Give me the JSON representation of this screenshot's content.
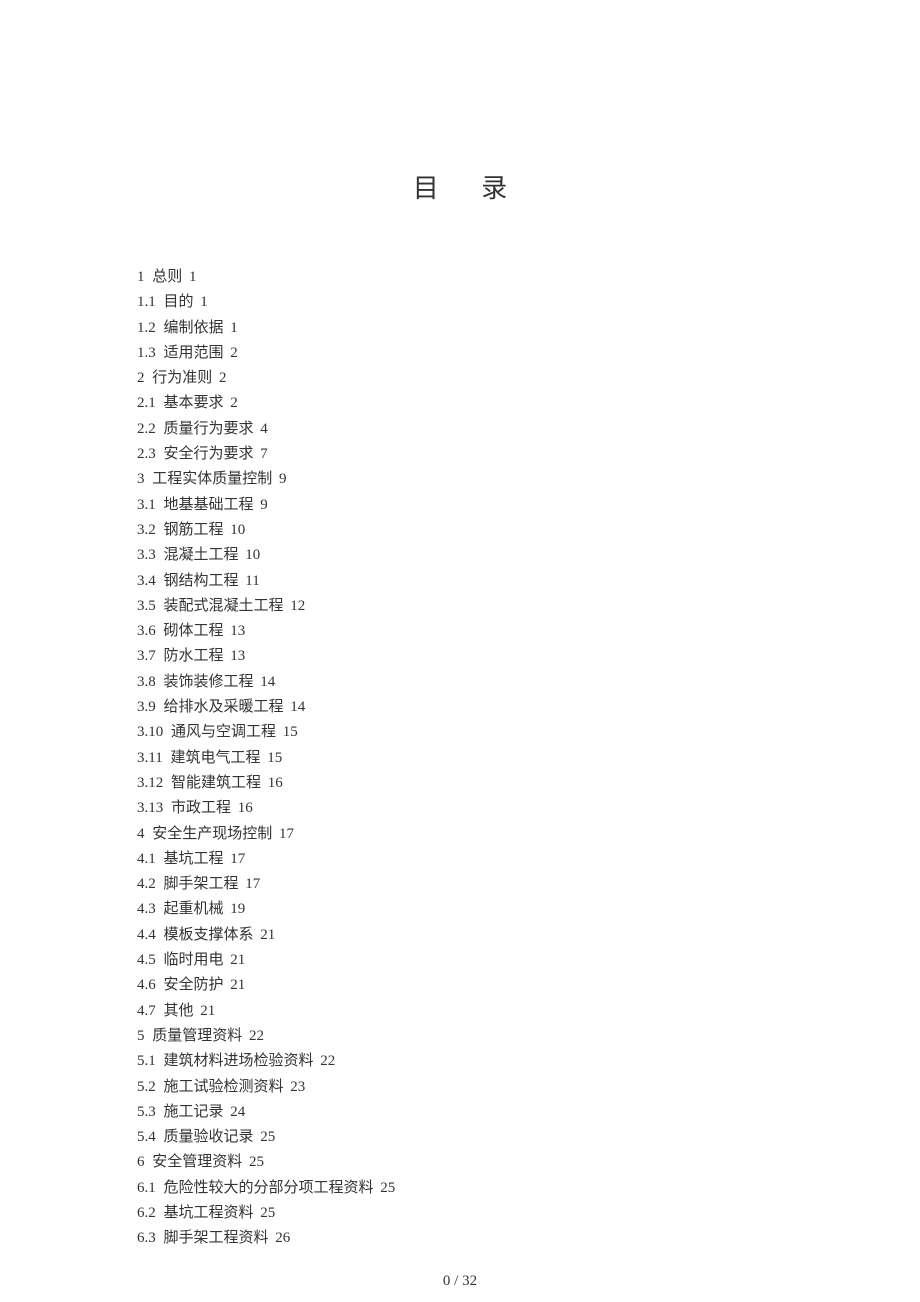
{
  "title": "目 录",
  "toc": [
    {
      "num": "1",
      "label": "总则",
      "page": "1"
    },
    {
      "num": "1.1",
      "label": "目的",
      "page": "1"
    },
    {
      "num": "1.2",
      "label": "编制依据",
      "page": "1"
    },
    {
      "num": "1.3",
      "label": "适用范围",
      "page": "2"
    },
    {
      "num": "2",
      "label": "行为准则",
      "page": "2"
    },
    {
      "num": "2.1",
      "label": "基本要求",
      "page": "2"
    },
    {
      "num": "2.2",
      "label": "质量行为要求",
      "page": "4"
    },
    {
      "num": "2.3",
      "label": "安全行为要求",
      "page": "7"
    },
    {
      "num": "3",
      "label": "工程实体质量控制",
      "page": "9"
    },
    {
      "num": "3.1",
      "label": "地基基础工程",
      "page": "9"
    },
    {
      "num": "3.2",
      "label": "钢筋工程",
      "page": "10"
    },
    {
      "num": "3.3",
      "label": "混凝土工程",
      "page": "10"
    },
    {
      "num": "3.4",
      "label": "钢结构工程",
      "page": "11"
    },
    {
      "num": "3.5",
      "label": "装配式混凝土工程",
      "page": "12"
    },
    {
      "num": "3.6",
      "label": "砌体工程",
      "page": "13"
    },
    {
      "num": "3.7",
      "label": "防水工程",
      "page": "13"
    },
    {
      "num": "3.8",
      "label": "装饰装修工程",
      "page": "14"
    },
    {
      "num": "3.9",
      "label": "给排水及采暖工程",
      "page": "14"
    },
    {
      "num": "3.10",
      "label": "通风与空调工程",
      "page": "15"
    },
    {
      "num": "3.11",
      "label": "建筑电气工程",
      "page": "15"
    },
    {
      "num": "3.12",
      "label": "智能建筑工程",
      "page": "16"
    },
    {
      "num": "3.13",
      "label": "市政工程",
      "page": "16"
    },
    {
      "num": "4",
      "label": "安全生产现场控制",
      "page": "17"
    },
    {
      "num": "4.1",
      "label": "基坑工程",
      "page": "17"
    },
    {
      "num": "4.2",
      "label": "脚手架工程",
      "page": "17"
    },
    {
      "num": "4.3",
      "label": "起重机械",
      "page": "19"
    },
    {
      "num": "4.4",
      "label": "模板支撑体系",
      "page": "21"
    },
    {
      "num": "4.5",
      "label": "临时用电",
      "page": "21"
    },
    {
      "num": "4.6",
      "label": "安全防护",
      "page": "21"
    },
    {
      "num": "4.7",
      "label": "其他",
      "page": "21"
    },
    {
      "num": "5",
      "label": "质量管理资料",
      "page": "22"
    },
    {
      "num": "5.1",
      "label": "建筑材料进场检验资料",
      "page": "22"
    },
    {
      "num": "5.2",
      "label": "施工试验检测资料",
      "page": "23"
    },
    {
      "num": "5.3",
      "label": "施工记录",
      "page": "24"
    },
    {
      "num": "5.4",
      "label": "质量验收记录",
      "page": "25"
    },
    {
      "num": "6",
      "label": "安全管理资料",
      "page": "25"
    },
    {
      "num": "6.1",
      "label": "危险性较大的分部分项工程资料",
      "page": "25"
    },
    {
      "num": "6.2",
      "label": "基坑工程资料",
      "page": "25"
    },
    {
      "num": "6.3",
      "label": "脚手架工程资料",
      "page": "26"
    }
  ],
  "footer": "0  / 32"
}
